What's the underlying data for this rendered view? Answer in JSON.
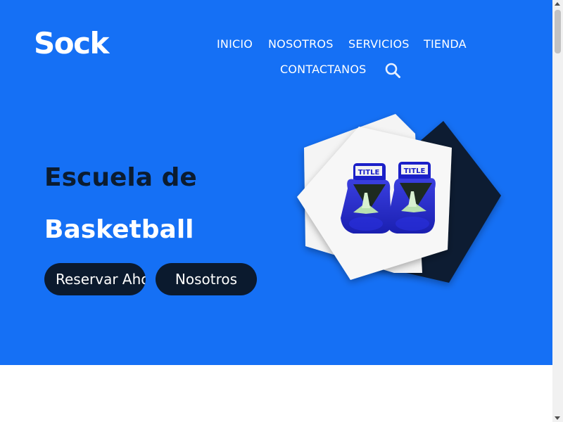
{
  "logo": "Sock",
  "nav": {
    "items": [
      "INICIO",
      "NOSOTROS",
      "SERVICIOS",
      "TIENDA",
      "CONTACTANOS"
    ]
  },
  "icons": {
    "search": "search-icon",
    "gloves": "boxing-gloves-image"
  },
  "hero": {
    "heading_line1": "Escuela de",
    "heading_line2": "Basketball",
    "btn_reserve": "Reservar Ahor",
    "btn_about": "Nosotros"
  },
  "colors": {
    "hero_bg": "#1570f5",
    "dark": "#0b1a2e",
    "white": "#ffffff"
  }
}
